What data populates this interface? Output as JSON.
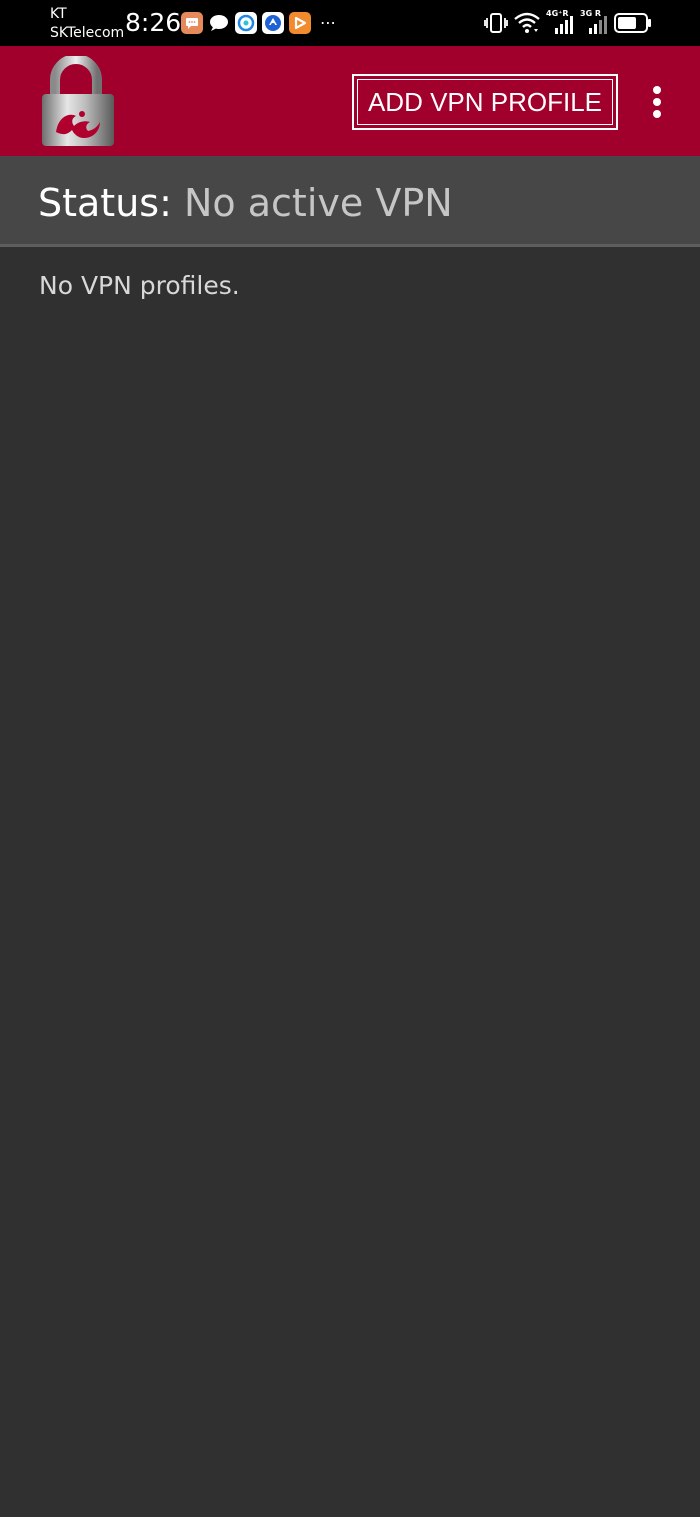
{
  "status_bar": {
    "carrier_line1": "KT",
    "carrier_line2": "SKTelecom",
    "time": "8:26",
    "notification_icons": [
      "chat-bubble-icon",
      "message-icon",
      "browser-icon",
      "app-circle-icon",
      "play-arrow-icon"
    ],
    "overflow": "⋯",
    "network_1": "4G⁺R",
    "network_2": "3G R"
  },
  "app_bar": {
    "logo": "padlock-logo-icon",
    "add_profile_label": "ADD VPN PROFILE",
    "menu_icon": "more-vertical-icon",
    "brand_color": "#a0002b"
  },
  "status": {
    "label": "Status:",
    "value": "No active VPN"
  },
  "profiles": {
    "empty_message": "No VPN profiles."
  },
  "colors": {
    "background": "#303030",
    "status_panel": "#474747",
    "accent": "#a0002b"
  }
}
